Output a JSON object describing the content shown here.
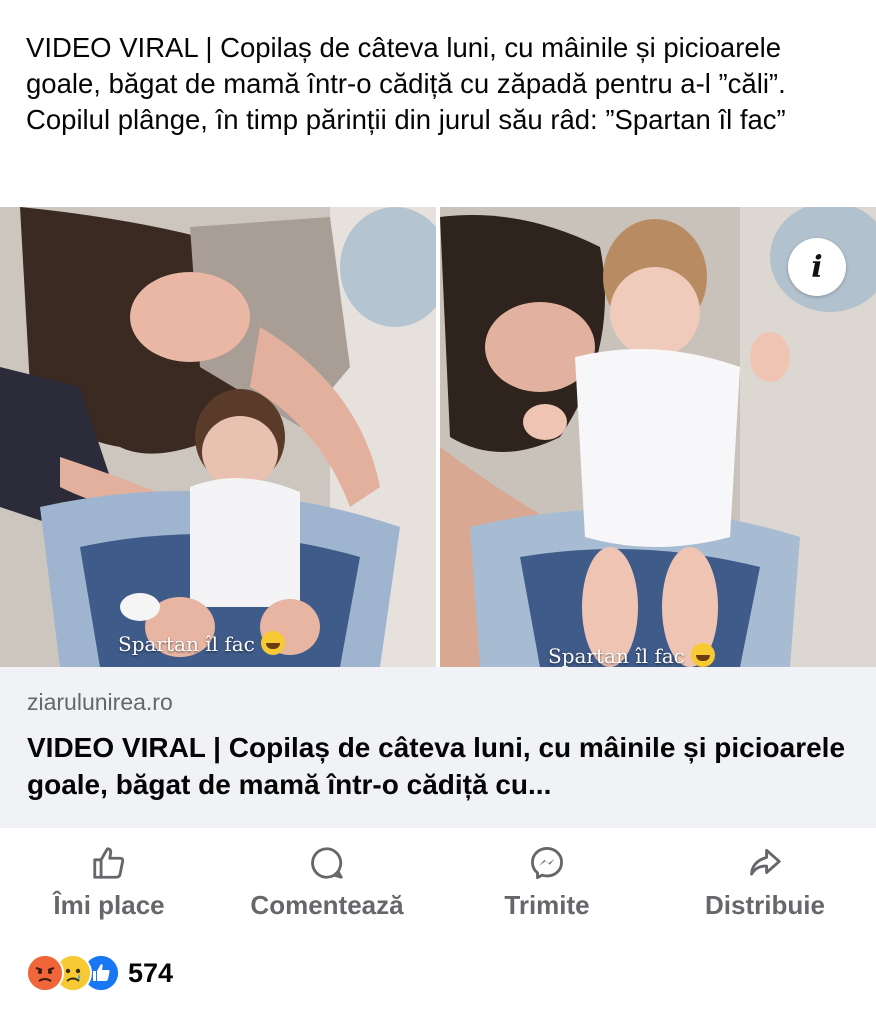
{
  "post": {
    "text": "VIDEO VIRAL | Copilaș de câteva luni, cu mâinile și picioarele goale, băgat de mamă într-o cădiță cu zăpadă pentru a-l ”căli”. Copilul plânge, în timp părinții din jurul său râd: ”Spartan îl fac”"
  },
  "media": {
    "captions": [
      "Spartan îl fac",
      "Spartan îl fac"
    ],
    "info_glyph": "i",
    "icons": [
      "info-icon",
      "grinning-emoji"
    ]
  },
  "link": {
    "domain": "ziarulunirea.ro",
    "title": "VIDEO VIRAL | Copilaș de câteva luni, cu mâinile și picioarele goale, băgat de mamă într-o cădiță cu..."
  },
  "actions": [
    {
      "label": "Îmi place",
      "icon": "like-icon"
    },
    {
      "label": "Comentează",
      "icon": "comment-icon"
    },
    {
      "label": "Trimite",
      "icon": "messenger-icon"
    },
    {
      "label": "Distribuie",
      "icon": "share-icon"
    }
  ],
  "reactions": {
    "icons": [
      "angry-reaction",
      "sad-reaction",
      "like-reaction"
    ],
    "count": "574"
  },
  "colors": {
    "secondary_text": "#65676b",
    "card_bg": "#f0f2f5",
    "like_blue": "#1877f2"
  }
}
